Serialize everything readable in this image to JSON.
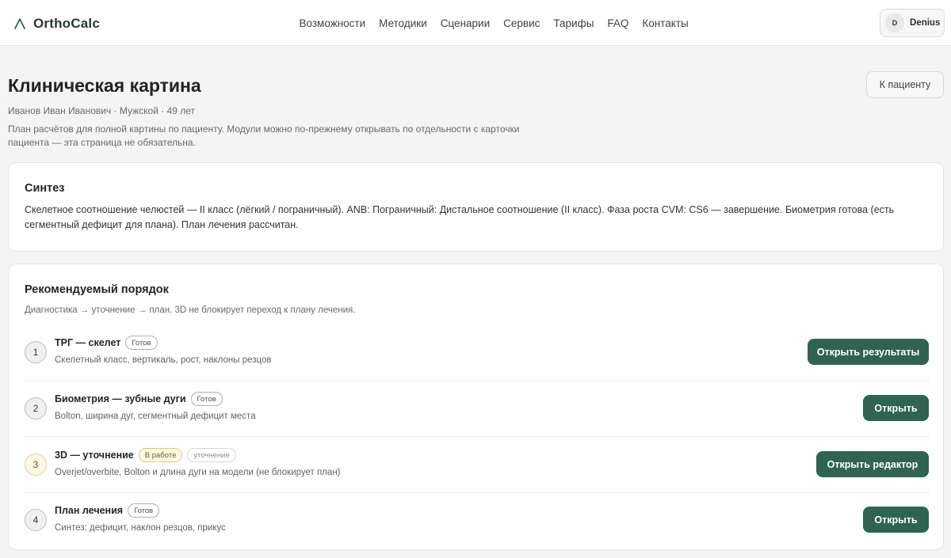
{
  "brand": {
    "name": "OrthoCalc"
  },
  "nav": [
    "Возможности",
    "Методики",
    "Сценарии",
    "Сервис",
    "Тарифы",
    "FAQ",
    "Контакты"
  ],
  "user": {
    "initial": "D",
    "name": "Denius"
  },
  "page": {
    "title": "Клиническая картина",
    "patient": "Иванов Иван Иванович · Мужской · 49 лет",
    "description": "План расчётов для полной картины по пациенту. Модули можно по-прежнему открывать по отдельности с карточки пациента — эта страница не обязательна.",
    "back_label": "К пациенту"
  },
  "synthesis": {
    "title": "Синтез",
    "text": "Скелетное соотношение челюстей — II класс (лёгкий / пограничный). ANB: Пограничный: Дистальное соотношение (II класс). Фаза роста CVM: CS6 — завершение. Биометрия готова (есть сегментный дефицит для плана). План лечения рассчитан."
  },
  "order": {
    "title": "Рекомендуемый порядок",
    "subtitle": "Диагностика → уточнение → план. 3D не блокирует переход к плану лечения.",
    "steps": [
      {
        "num": "1",
        "title": "ТРГ — скелет",
        "badge": "Готов",
        "tag": "",
        "desc": "Скелетный класс, вертикаль, рост, наклоны резцов",
        "button": "Открыть результаты",
        "state": "done"
      },
      {
        "num": "2",
        "title": "Биометрия — зубные дуги",
        "badge": "Готов",
        "tag": "",
        "desc": "Bolton, ширина дуг, сегментный дефицит места",
        "button": "Открыть",
        "state": "done"
      },
      {
        "num": "3",
        "title": "3D — уточнение",
        "badge": "В работе",
        "tag": "уточнение",
        "desc": "Overjet/overbite, Bolton и длина дуги на модели (не блокирует план)",
        "button": "Открыть редактор",
        "state": "in-progress"
      },
      {
        "num": "4",
        "title": "План лечения",
        "badge": "Готов",
        "tag": "",
        "desc": "Синтез: дефицит, наклон резцов, прикус",
        "button": "Открыть",
        "state": "done"
      }
    ]
  },
  "colors": {
    "accent": "#2f6452",
    "background": "#f3f4f4",
    "in_progress": "#fbf8e3"
  }
}
